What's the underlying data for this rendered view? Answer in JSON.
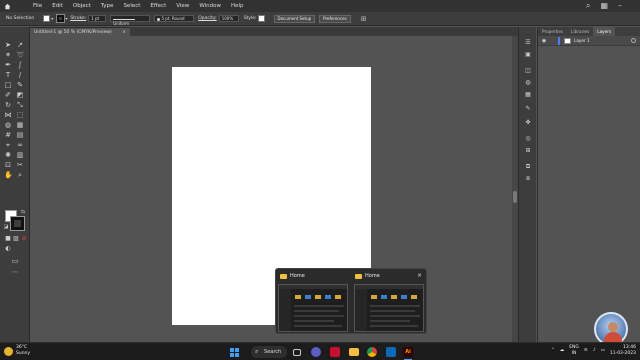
{
  "menubar": {
    "items": [
      "File",
      "Edit",
      "Object",
      "Type",
      "Select",
      "Effect",
      "View",
      "Window",
      "Help"
    ]
  },
  "controlbar": {
    "selection_label": "No Selection",
    "stroke_label": "Stroke:",
    "stroke_value": "1 pt",
    "profile_value": "Uniform",
    "brush_value": "5 pt. Round",
    "opacity_label": "Opacity:",
    "opacity_value": "100%",
    "style_label": "Style:",
    "document_setup": "Document Setup",
    "preferences": "Preferences"
  },
  "document": {
    "tab_title": "Untitled-1 @ 50 % (CMYK/Preview)",
    "close_glyph": "×"
  },
  "panel": {
    "tabs": [
      "Properties",
      "Libraries",
      "Layers"
    ],
    "active_tab": "Layers",
    "layers": [
      {
        "name": "Layer 1"
      }
    ]
  },
  "taskbar_popup": {
    "items": [
      {
        "title": "Home"
      },
      {
        "title": "Home"
      }
    ],
    "close_glyph": "×"
  },
  "taskbar": {
    "weather_temp": "36°C",
    "weather_desc": "Sunny",
    "search_label": "Search",
    "lang_line1": "ENG",
    "lang_line2": "IN",
    "time": "13:46",
    "date": "11-03-2023"
  },
  "colors": {
    "ui_dark": "#323232",
    "ui_panel": "#3d3d3d",
    "canvas": "#535353",
    "artboard": "#ffffff",
    "layer_accent": "#4a7cff",
    "ai_brand": "#ff9a00"
  }
}
